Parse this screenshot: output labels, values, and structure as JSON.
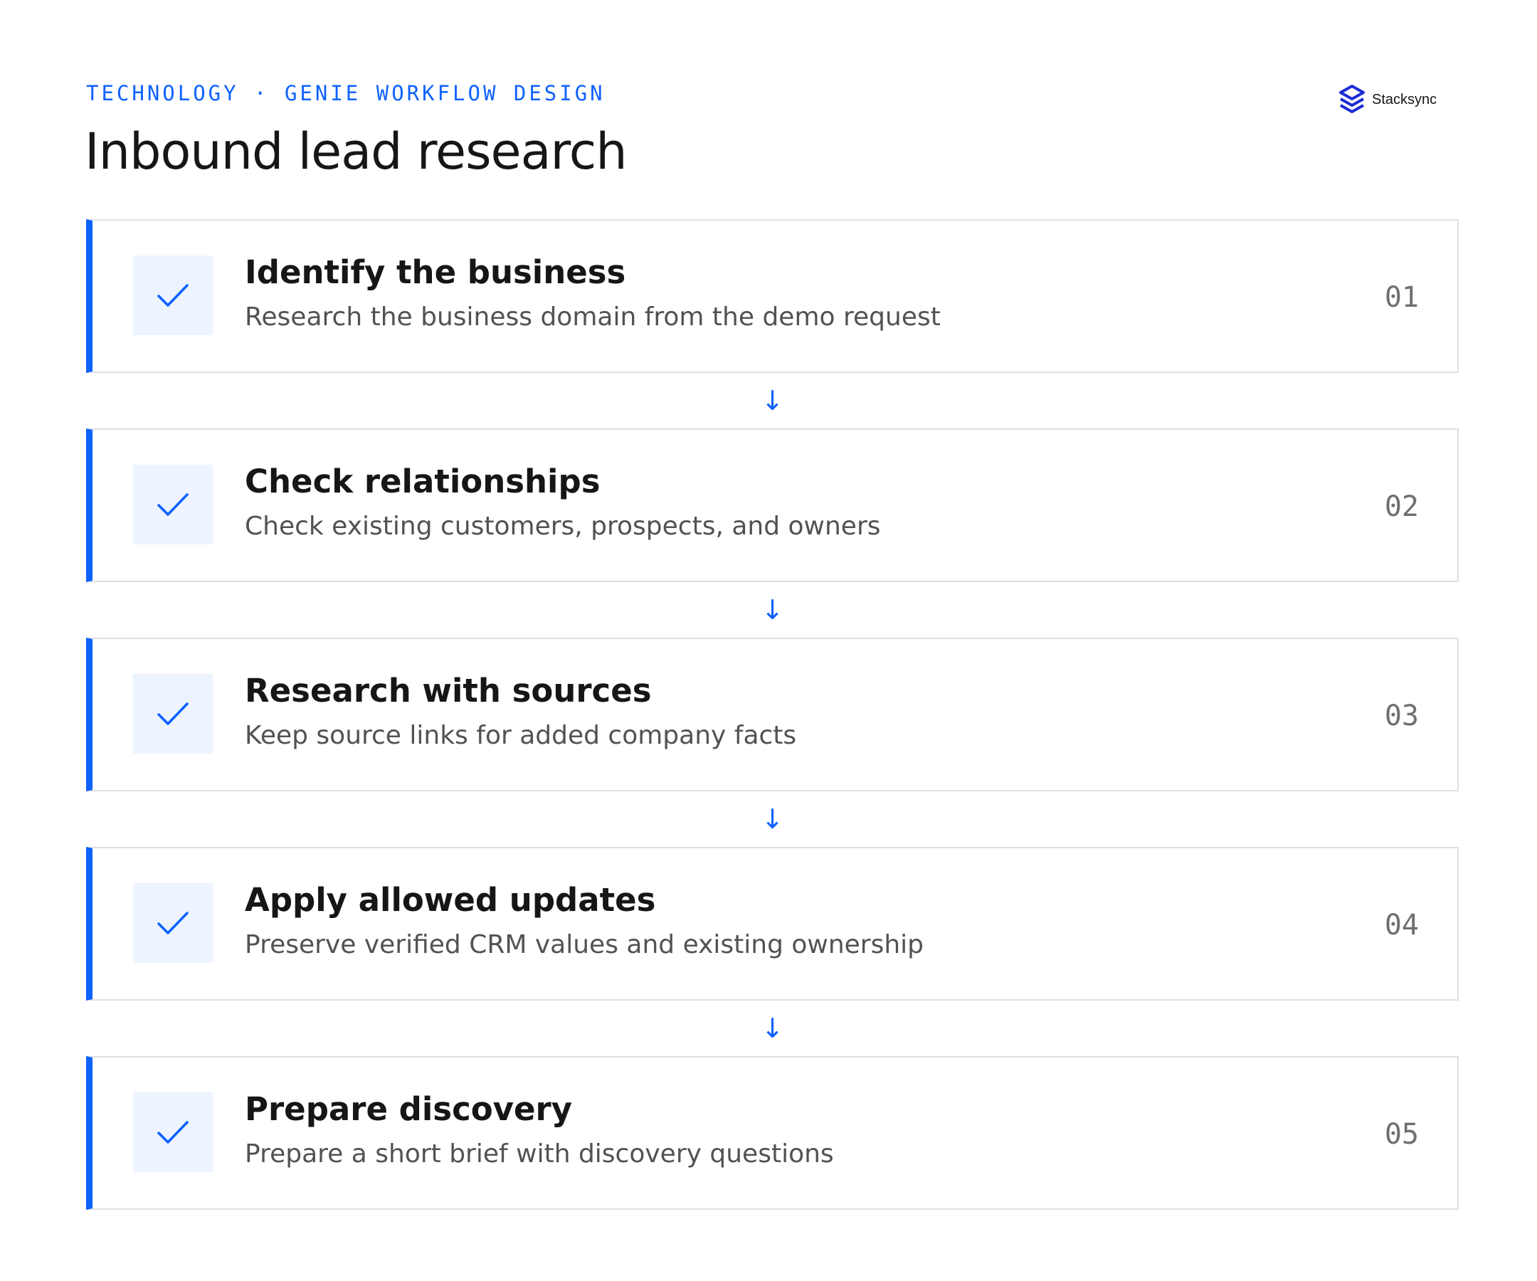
{
  "header": {
    "eyebrow": "TECHNOLOGY · GENIE WORKFLOW DESIGN",
    "title": "Inbound lead research"
  },
  "brand": {
    "name": "Stacksync",
    "logo_icon": "stacksync-logo-icon"
  },
  "colors": {
    "accent": "#0f62fe",
    "check_background": "#edf4ff",
    "card_border": "#e0e0e0",
    "title_text": "#161616",
    "description_text": "#525252",
    "number_text": "#6f6f6f"
  },
  "connector": {
    "arrow": "↓",
    "icon": "arrow-down-icon"
  },
  "steps": [
    {
      "title": "Identify the business",
      "description": "Research the business domain from the demo request",
      "number": "01",
      "status_icon": "check-icon"
    },
    {
      "title": "Check relationships",
      "description": "Check existing customers, prospects, and owners",
      "number": "02",
      "status_icon": "check-icon"
    },
    {
      "title": "Research with sources",
      "description": "Keep source links for added company facts",
      "number": "03",
      "status_icon": "check-icon"
    },
    {
      "title": "Apply allowed updates",
      "description": "Preserve verified CRM values and existing ownership",
      "number": "04",
      "status_icon": "check-icon"
    },
    {
      "title": "Prepare discovery",
      "description": "Prepare a short brief with discovery questions",
      "number": "05",
      "status_icon": "check-icon"
    }
  ]
}
